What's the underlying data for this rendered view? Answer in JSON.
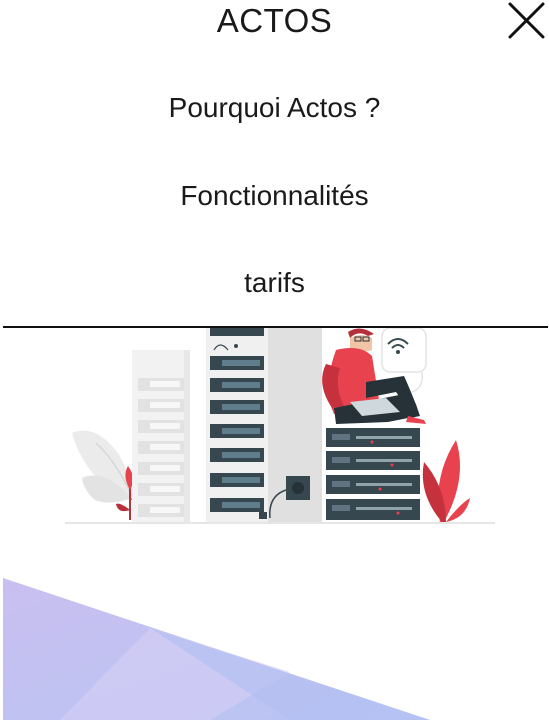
{
  "header": {
    "brand": "ACTOS",
    "close_icon": "close-icon"
  },
  "nav": {
    "items": [
      {
        "label": "Pourquoi Actos ?"
      },
      {
        "label": "Fonctionnalités"
      },
      {
        "label": "tarifs"
      }
    ]
  },
  "illustration": {
    "icons": [
      "server-rack-icon",
      "person-laptop-icon",
      "wifi-icon",
      "plant-icon"
    ]
  },
  "colors": {
    "text": "#1a1a1a",
    "divider": "#111111",
    "accent_red": "#e8424f",
    "server_dark": "#37474f",
    "bg_violet": "#c9bff0",
    "bg_blue": "#b7c5f3"
  }
}
